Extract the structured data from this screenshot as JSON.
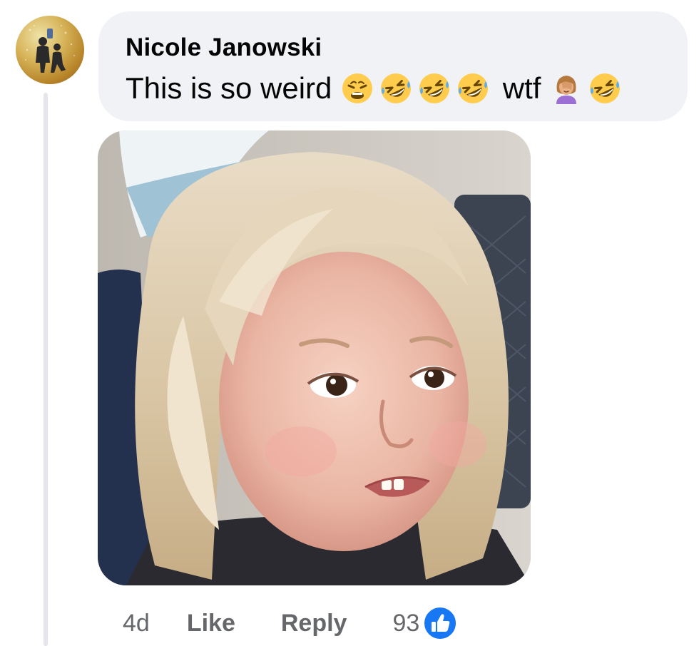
{
  "comment": {
    "author": "Nicole Janowski",
    "text_prefix": "This is so weird ",
    "text_mid": " wtf ",
    "emojis_before": [
      "weary-face-emoji",
      "rolling-on-floor-laughing-emoji",
      "rolling-on-floor-laughing-emoji",
      "rolling-on-floor-laughing-emoji"
    ],
    "emojis_after": [
      "woman-facepalming-emoji",
      "rolling-on-floor-laughing-emoji"
    ]
  },
  "attachment": {
    "type": "gif",
    "subject": "side-eye-girl-gif"
  },
  "actions": {
    "timestamp": "4d",
    "like_label": "Like",
    "reply_label": "Reply",
    "reaction_count": "93",
    "reaction_icon": "like-thumb-icon"
  },
  "colors": {
    "bubble_bg": "#f0f2f5",
    "text": "#050505",
    "secondary_text": "#65676b",
    "like_blue": "#1877f2",
    "thread_line": "#e4e6eb"
  }
}
